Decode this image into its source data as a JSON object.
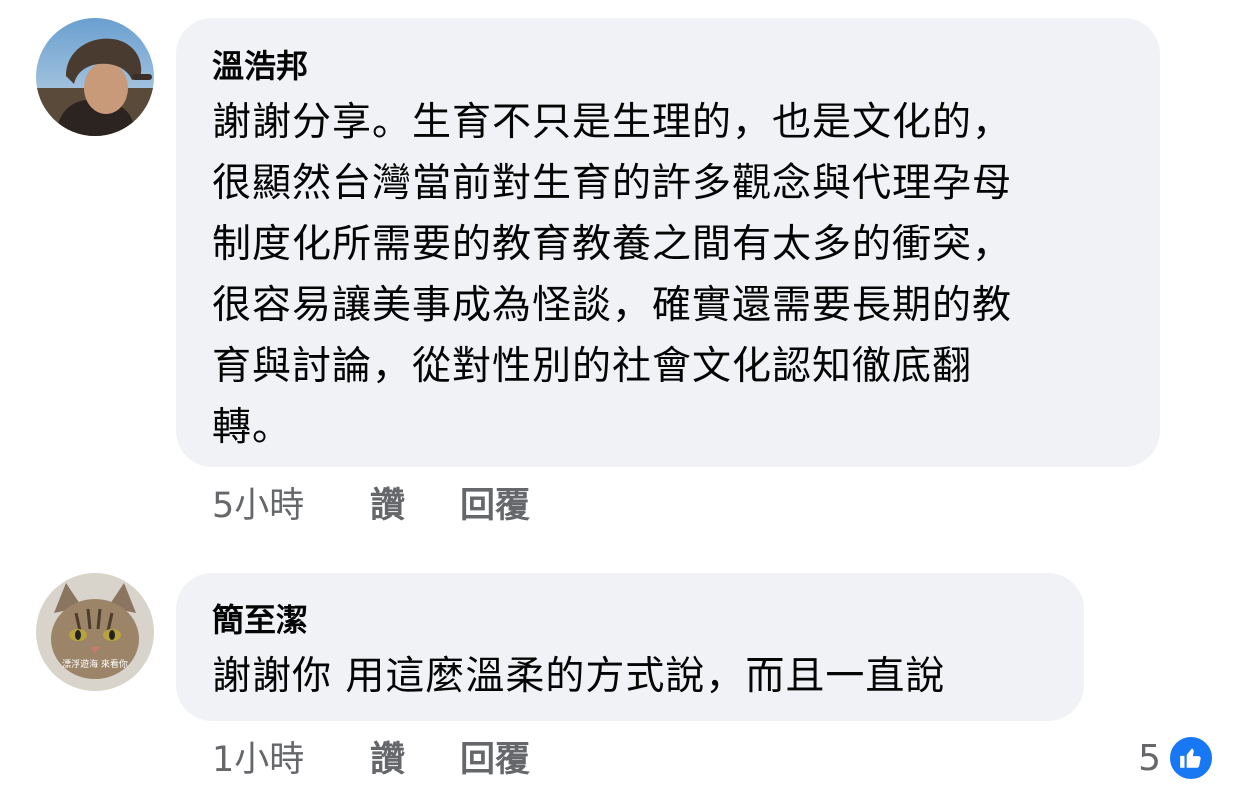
{
  "comments": [
    {
      "author": "溫浩邦",
      "body_lines": [
        "謝謝分享。生育不只是生理的，也是文化的，",
        "很顯然台灣當前對生育的許多觀念與代理孕母",
        "制度化所需要的教育教養之間有太多的衝突，",
        "很容易讓美事成為怪談，確實還需要長期的教",
        "育與討論，從對性別的社會文化認知徹底翻",
        "轉。"
      ],
      "time": "5小時",
      "like_label": "讚",
      "reply_label": "回覆",
      "avatar_icon": "person-helmet-photo"
    },
    {
      "author": "簡至潔",
      "body_lines": [
        "謝謝你 用這麼溫柔的方式說，而且一直說"
      ],
      "time": "1小時",
      "like_label": "讚",
      "reply_label": "回覆",
      "avatar_icon": "cat-photo",
      "avatar_caption": "漂浮遊海 來看你",
      "reactions": {
        "count": "5",
        "icon": "like-thumbs-up-icon",
        "color": "#1877f2"
      }
    }
  ],
  "colors": {
    "bubble_bg": "#f0f2f5",
    "text": "#050505",
    "meta": "#65676b",
    "like_blue": "#1877f2"
  }
}
